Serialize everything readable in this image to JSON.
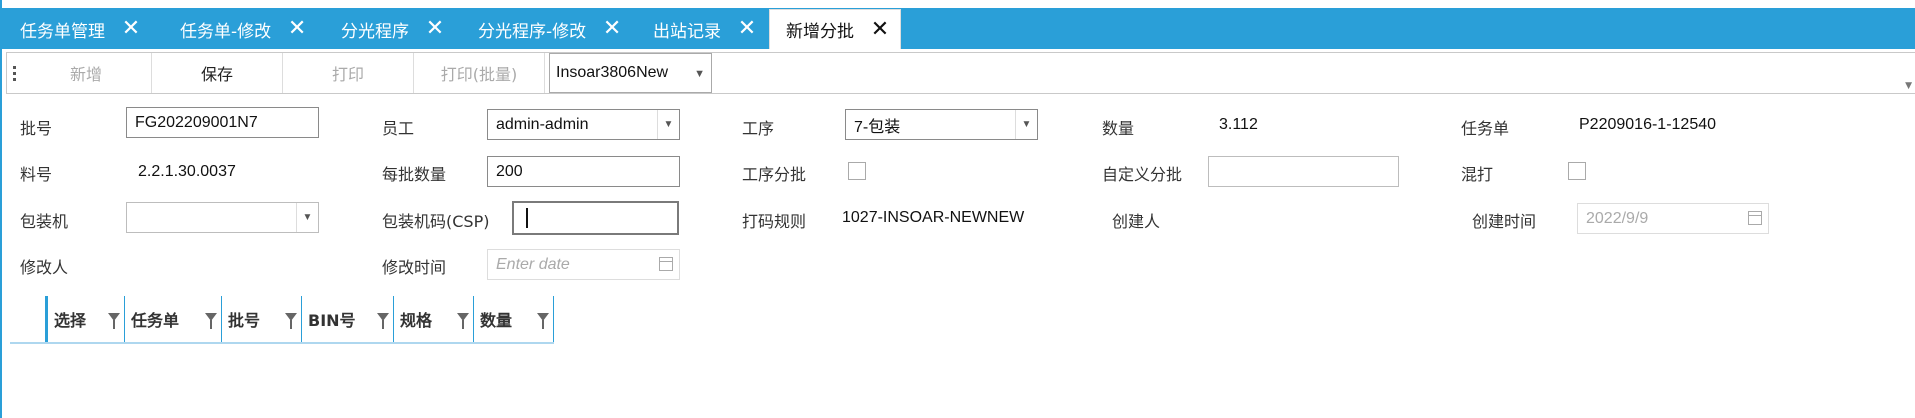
{
  "tabs": [
    {
      "label": "任务单管理",
      "active": false
    },
    {
      "label": "任务单-修改",
      "active": false
    },
    {
      "label": "分光程序",
      "active": false
    },
    {
      "label": "分光程序-修改",
      "active": false
    },
    {
      "label": "出站记录",
      "active": false
    },
    {
      "label": "新增分批",
      "active": true
    }
  ],
  "tab_close_glyph": "✕",
  "toolbar": {
    "add": "新增",
    "save": "保存",
    "print": "打印",
    "print_batch": "打印(批量)",
    "template_select": "Insoar3806New"
  },
  "form": {
    "batch_no_label": "批号",
    "batch_no_value": "FG202209001N7",
    "employee_label": "员工",
    "employee_value": "admin-admin",
    "process_label": "工序",
    "process_value": "7-包装",
    "quantity_label": "数量",
    "quantity_value": "3.112",
    "task_label": "任务单",
    "task_value": "P2209016-1-12540",
    "material_label": "料号",
    "material_value": "2.2.1.30.0037",
    "per_batch_label": "每批数量",
    "per_batch_value": "200",
    "process_split_label": "工序分批",
    "custom_split_label": "自定义分批",
    "custom_split_value": "",
    "mixed_label": "混打",
    "packer_label": "包装机",
    "packer_value": "",
    "packer_code_label": "包装机码(CSP)",
    "packer_code_value": "",
    "code_rule_label": "打码规则",
    "code_rule_value": "1027-INSOAR-NEWNEW",
    "creator_label": "创建人",
    "creator_value": "",
    "create_time_label": "创建时间",
    "create_time_value": "2022/9/9",
    "modifier_label": "修改人",
    "modifier_value": "",
    "modify_time_label": "修改时间",
    "modify_time_placeholder": "Enter date"
  },
  "grid": {
    "columns": [
      "选择",
      "任务单",
      "批号",
      "BIN号",
      "规格",
      "数量"
    ]
  },
  "colors": {
    "accent": "#2a9fd8"
  }
}
